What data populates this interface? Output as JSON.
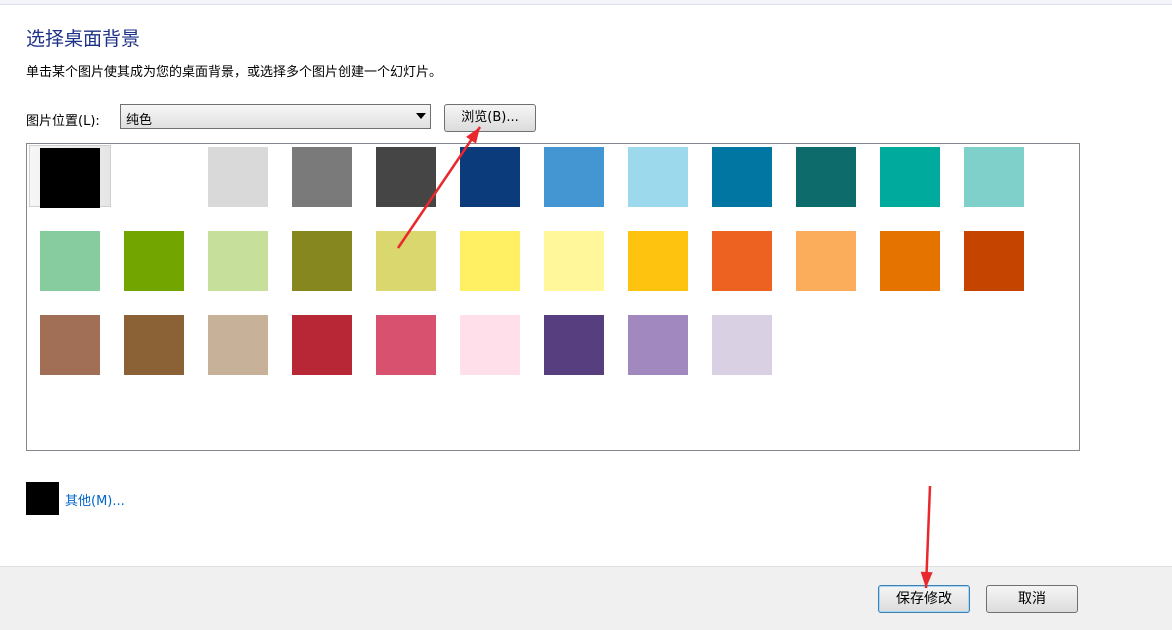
{
  "header": {
    "title": "选择桌面背景",
    "description": "单击某个图片使其成为您的桌面背景，或选择多个图片创建一个幻灯片。"
  },
  "picture_position": {
    "label": "图片位置(L):",
    "selected": "纯色"
  },
  "browse_label": "浏览(B)...",
  "colors": [
    "#000000",
    "#ffffff",
    "#d9d9d9",
    "#7a7a7a",
    "#454545",
    "#0b3b7a",
    "#4496d3",
    "#9cd9ed",
    "#0176a3",
    "#0e6b6c",
    "#00aa9c",
    "#7fcfca",
    "#86cc9e",
    "#73a500",
    "#c6e09c",
    "#86871f",
    "#dbd76f",
    "#fff063",
    "#fff799",
    "#fec30e",
    "#ed6220",
    "#fcad5b",
    "#e57300",
    "#c44400",
    "#a06f55",
    "#8b6136",
    "#c7b198",
    "#b82735",
    "#d8516f",
    "#fedfea",
    "#573e7f",
    "#a188bf",
    "#d9d0e4"
  ],
  "selected_color_index": 0,
  "other": {
    "color": "#000000",
    "label": "其他(M)..."
  },
  "footer": {
    "save_label": "保存修改",
    "cancel_label": "取消"
  },
  "annotation_color": "#e8282d"
}
